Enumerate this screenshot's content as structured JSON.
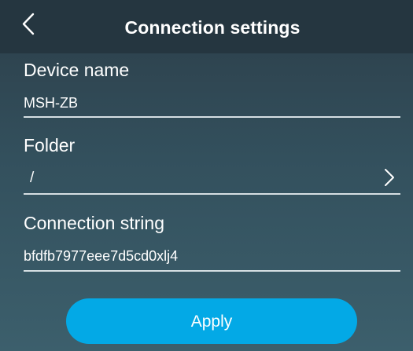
{
  "header": {
    "title": "Connection settings",
    "back_icon": "chevron-left-icon"
  },
  "fields": {
    "device_name": {
      "label": "Device name",
      "value": "MSH-ZB"
    },
    "folder": {
      "label": "Folder",
      "value": "/",
      "chevron_icon": "chevron-right-icon"
    },
    "connection_string": {
      "label": "Connection string",
      "value": "bfdfb7977eee7d5cd0xlj4"
    }
  },
  "actions": {
    "apply_label": "Apply"
  },
  "colors": {
    "header_bg": "#253640",
    "background": "#33505d",
    "accent": "#03a9e6",
    "underline": "#d6dfe3"
  }
}
